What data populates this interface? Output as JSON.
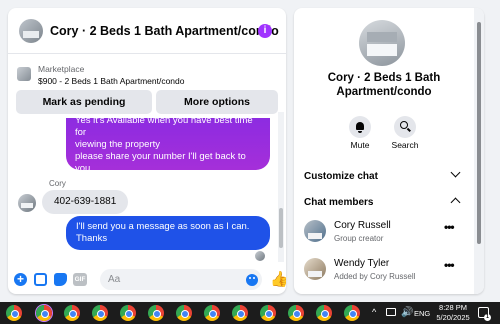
{
  "chat": {
    "title": "Cory · 2 Beds 1 Bath Apartment/condo",
    "info_icon": "i",
    "marketplace_label": "Marketplace",
    "marketplace_item": "$900 - 2 Beds 1 Bath Apartment/condo",
    "mark_pending_label": "Mark as pending",
    "more_options_label": "More options",
    "messages": [
      {
        "from": "me",
        "lines": [
          "Yes it's Available when you have best time for",
          "viewing the property",
          "please share your number I'll get back to you",
          "soon"
        ]
      },
      {
        "from": "Cory",
        "sender_name": "Cory",
        "text": "402-639-1881"
      },
      {
        "from": "me",
        "lines": [
          "I'll send you a message as soon as I can.",
          "Thanks"
        ]
      }
    ],
    "composer": {
      "placeholder": "Aa",
      "gif_label": "GIF",
      "icons": [
        "plus-icon",
        "photo-icon",
        "sticker-icon",
        "gif-icon",
        "emoji-icon",
        "like-icon"
      ]
    }
  },
  "info": {
    "title_line1": "Cory · 2 Beds 1 Bath",
    "title_line2": "Apartment/condo",
    "mute_label": "Mute",
    "search_label": "Search",
    "customize_chat_label": "Customize chat",
    "chat_members_label": "Chat members",
    "members": [
      {
        "name": "Cory Russell",
        "role": "Group creator"
      },
      {
        "name": "Wendy Tyler",
        "role": "Added by Cory Russell"
      }
    ],
    "more_glyph": "•••"
  },
  "taskbar": {
    "app_icons": [
      "chrome-icon",
      "chrome-icon",
      "chrome-icon",
      "chrome-icon",
      "chrome-icon",
      "chrome-icon",
      "chrome-icon",
      "chrome-icon",
      "chrome-icon",
      "chrome-icon",
      "chrome-icon",
      "chrome-icon",
      "chrome-icon"
    ],
    "language": "ENG",
    "time": "8:28 PM",
    "date": "5/20/2025",
    "notification_count": "1"
  },
  "colors": {
    "accent_purple": "#a033ff",
    "outgoing_bubble": "#1f52e8",
    "messenger_blue": "#1877f2",
    "taskbar_bg": "#1c1c1c"
  }
}
